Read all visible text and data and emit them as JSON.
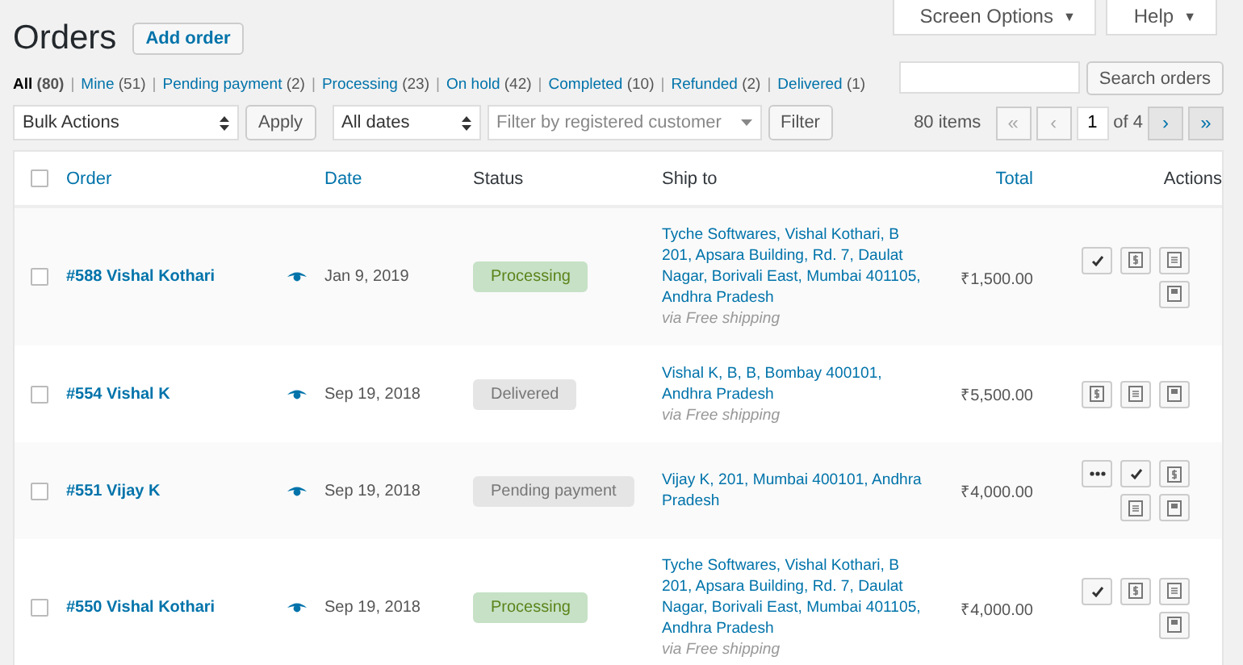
{
  "top_tabs": [
    {
      "label": "Screen Options",
      "caret": "▼"
    },
    {
      "label": "Help",
      "caret": "▼"
    }
  ],
  "title": "Orders",
  "add_button": "Add order",
  "status_filters": {
    "separator": "|",
    "items": [
      {
        "label": "All",
        "count": "(80)",
        "selected": true
      },
      {
        "label": "Mine",
        "count": "(51)",
        "selected": false
      },
      {
        "label": "Pending payment",
        "count": "(2)",
        "selected": false
      },
      {
        "label": "Processing",
        "count": "(23)",
        "selected": false
      },
      {
        "label": "On hold",
        "count": "(42)",
        "selected": false
      },
      {
        "label": "Completed",
        "count": "(10)",
        "selected": false
      },
      {
        "label": "Refunded",
        "count": "(2)",
        "selected": false
      },
      {
        "label": "Delivered",
        "count": "(1)",
        "selected": false
      }
    ]
  },
  "search": {
    "button": "Search orders"
  },
  "bulk_actions": {
    "value": "Bulk Actions",
    "button": "Apply"
  },
  "date_filter": {
    "value": "All dates"
  },
  "customer_filter": {
    "placeholder": "Filter by registered customer",
    "button": "Filter"
  },
  "pagination": {
    "items_count": "80 items",
    "page": "1",
    "of_pages": "of 4",
    "buttons": [
      {
        "label": "«",
        "disabled": true
      },
      {
        "label": "‹",
        "disabled": true
      },
      {
        "label": "›",
        "disabled": false
      },
      {
        "label": "»",
        "disabled": false
      }
    ]
  },
  "table": {
    "select_all": {
      "checked": false
    },
    "columns": [
      {
        "label": "Order",
        "sortable": true
      },
      {
        "label": "Date",
        "sortable": true
      },
      {
        "label": "Status",
        "sortable": false
      },
      {
        "label": "Ship to",
        "sortable": false
      },
      {
        "label": "Total",
        "sortable": true
      },
      {
        "label": "Actions",
        "sortable": false
      }
    ],
    "rows": [
      {
        "checked": false,
        "order": "#588 Vishal Kothari",
        "date": "Jan 9, 2019",
        "status": {
          "label": "Processing",
          "kind": "processing"
        },
        "ship_to": "Tyche Softwares, Vishal Kothari, B 201, Apsara Building, Rd. 7, Daulat Nagar, Borivali East, Mumbai 401105, Andhra Pradesh",
        "shipping_method": "via Free shipping",
        "total": "₹1,500.00",
        "actions": [
          {
            "kind": "complete"
          },
          {
            "kind": "invoice"
          },
          {
            "kind": "packing-slip"
          },
          {
            "kind": "label"
          }
        ]
      },
      {
        "checked": false,
        "order": "#554 Vishal K",
        "date": "Sep 19, 2018",
        "status": {
          "label": "Delivered",
          "kind": "neutral"
        },
        "ship_to": "Vishal K, B, B, Bombay 400101, Andhra Pradesh",
        "shipping_method": "via Free shipping",
        "total": "₹5,500.00",
        "actions": [
          {
            "kind": "invoice"
          },
          {
            "kind": "packing-slip"
          },
          {
            "kind": "label"
          }
        ]
      },
      {
        "checked": false,
        "order": "#551 Vijay K",
        "date": "Sep 19, 2018",
        "status": {
          "label": "Pending payment",
          "kind": "neutral"
        },
        "ship_to": "Vijay K, 201, Mumbai 400101, Andhra Pradesh",
        "total": "₹4,000.00",
        "actions": [
          {
            "kind": "more"
          },
          {
            "kind": "complete"
          },
          {
            "kind": "invoice"
          },
          {
            "kind": "packing-slip"
          },
          {
            "kind": "label"
          }
        ]
      },
      {
        "checked": false,
        "order": "#550 Vishal Kothari",
        "date": "Sep 19, 2018",
        "status": {
          "label": "Processing",
          "kind": "processing"
        },
        "ship_to": "Tyche Softwares, Vishal Kothari, B 201, Apsara Building, Rd. 7, Daulat Nagar, Borivali East, Mumbai 401105, Andhra Pradesh",
        "shipping_method": "via Free shipping",
        "total": "₹4,000.00",
        "actions": [
          {
            "kind": "complete"
          },
          {
            "kind": "invoice"
          },
          {
            "kind": "packing-slip"
          },
          {
            "kind": "label"
          }
        ]
      }
    ]
  }
}
